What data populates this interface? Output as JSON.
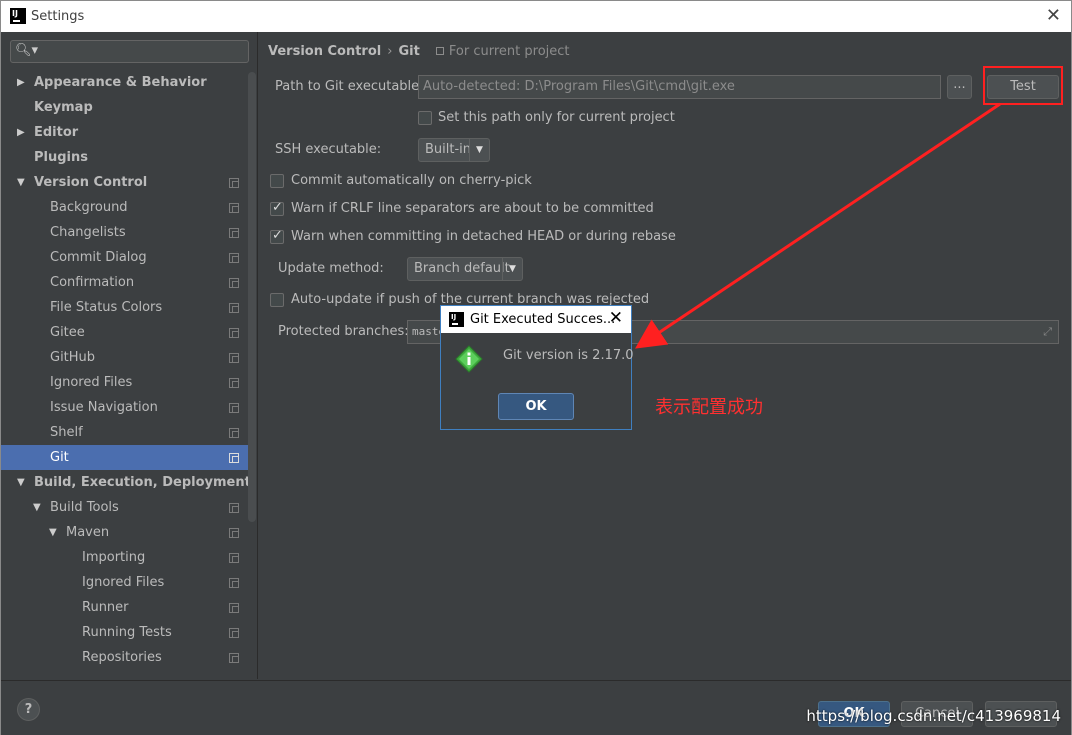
{
  "window": {
    "title": "Settings",
    "close_icon": "close-icon"
  },
  "search": {
    "placeholder": "",
    "value": ""
  },
  "sidebar": {
    "items": [
      {
        "label": "Appearance & Behavior",
        "level": 0,
        "arrow": "▶",
        "bold": true
      },
      {
        "label": "Keymap",
        "level": 0,
        "arrow": "",
        "bold": true
      },
      {
        "label": "Editor",
        "level": 0,
        "arrow": "▶",
        "bold": true
      },
      {
        "label": "Plugins",
        "level": 0,
        "arrow": "",
        "bold": true
      },
      {
        "label": "Version Control",
        "level": 0,
        "arrow": "▼",
        "bold": true,
        "proj": true
      },
      {
        "label": "Background",
        "level": 1,
        "proj": true
      },
      {
        "label": "Changelists",
        "level": 1,
        "proj": true
      },
      {
        "label": "Commit Dialog",
        "level": 1,
        "proj": true
      },
      {
        "label": "Confirmation",
        "level": 1,
        "proj": true
      },
      {
        "label": "File Status Colors",
        "level": 1,
        "proj": true
      },
      {
        "label": "Gitee",
        "level": 1,
        "proj": true
      },
      {
        "label": "GitHub",
        "level": 1,
        "proj": true
      },
      {
        "label": "Ignored Files",
        "level": 1,
        "proj": true
      },
      {
        "label": "Issue Navigation",
        "level": 1,
        "proj": true
      },
      {
        "label": "Shelf",
        "level": 1,
        "proj": true
      },
      {
        "label": "Git",
        "level": 1,
        "proj": true,
        "selected": true
      },
      {
        "label": "Build, Execution, Deployment",
        "level": 0,
        "arrow": "▼",
        "bold": true
      },
      {
        "label": "Build Tools",
        "level": 1,
        "arrow": "▼",
        "proj": true
      },
      {
        "label": "Maven",
        "level": 2,
        "arrow": "▼",
        "proj": true
      },
      {
        "label": "Importing",
        "level": 3,
        "proj": true
      },
      {
        "label": "Ignored Files",
        "level": 3,
        "proj": true
      },
      {
        "label": "Runner",
        "level": 3,
        "proj": true
      },
      {
        "label": "Running Tests",
        "level": 3,
        "proj": true
      },
      {
        "label": "Repositories",
        "level": 3,
        "proj": true
      }
    ]
  },
  "breadcrumb": {
    "part1": "Version Control",
    "sep": "›",
    "part2": "Git",
    "for_project": "For current project"
  },
  "git_settings": {
    "path_label": "Path to Git executable:",
    "path_value": "Auto-detected: D:\\Program Files\\Git\\cmd\\git.exe",
    "ellipsis": "...",
    "test_button": "Test",
    "set_path_only": "Set this path only for current project",
    "ssh_label": "SSH executable:",
    "ssh_value": "Built-in",
    "commit_cherry": "Commit automatically on cherry-pick",
    "warn_crlf": "Warn if CRLF line separators are about to be committed",
    "warn_detached": "Warn when committing in detached HEAD or during rebase",
    "update_method_label": "Update method:",
    "update_method_value": "Branch default",
    "auto_update": "Auto-update if push of the current branch was rejected",
    "protected_label": "Protected branches:",
    "protected_value": "master"
  },
  "dialog": {
    "title": "Git Executed Succes...",
    "message": "Git version is 2.17.0",
    "ok": "OK"
  },
  "annotation": {
    "note": "表示配置成功",
    "color": "#ff2020"
  },
  "bottom": {
    "help": "?",
    "ok": "OK",
    "cancel": "Cancel",
    "apply": "",
    "watermark": "https://blog.csdn.net/c413969814"
  }
}
